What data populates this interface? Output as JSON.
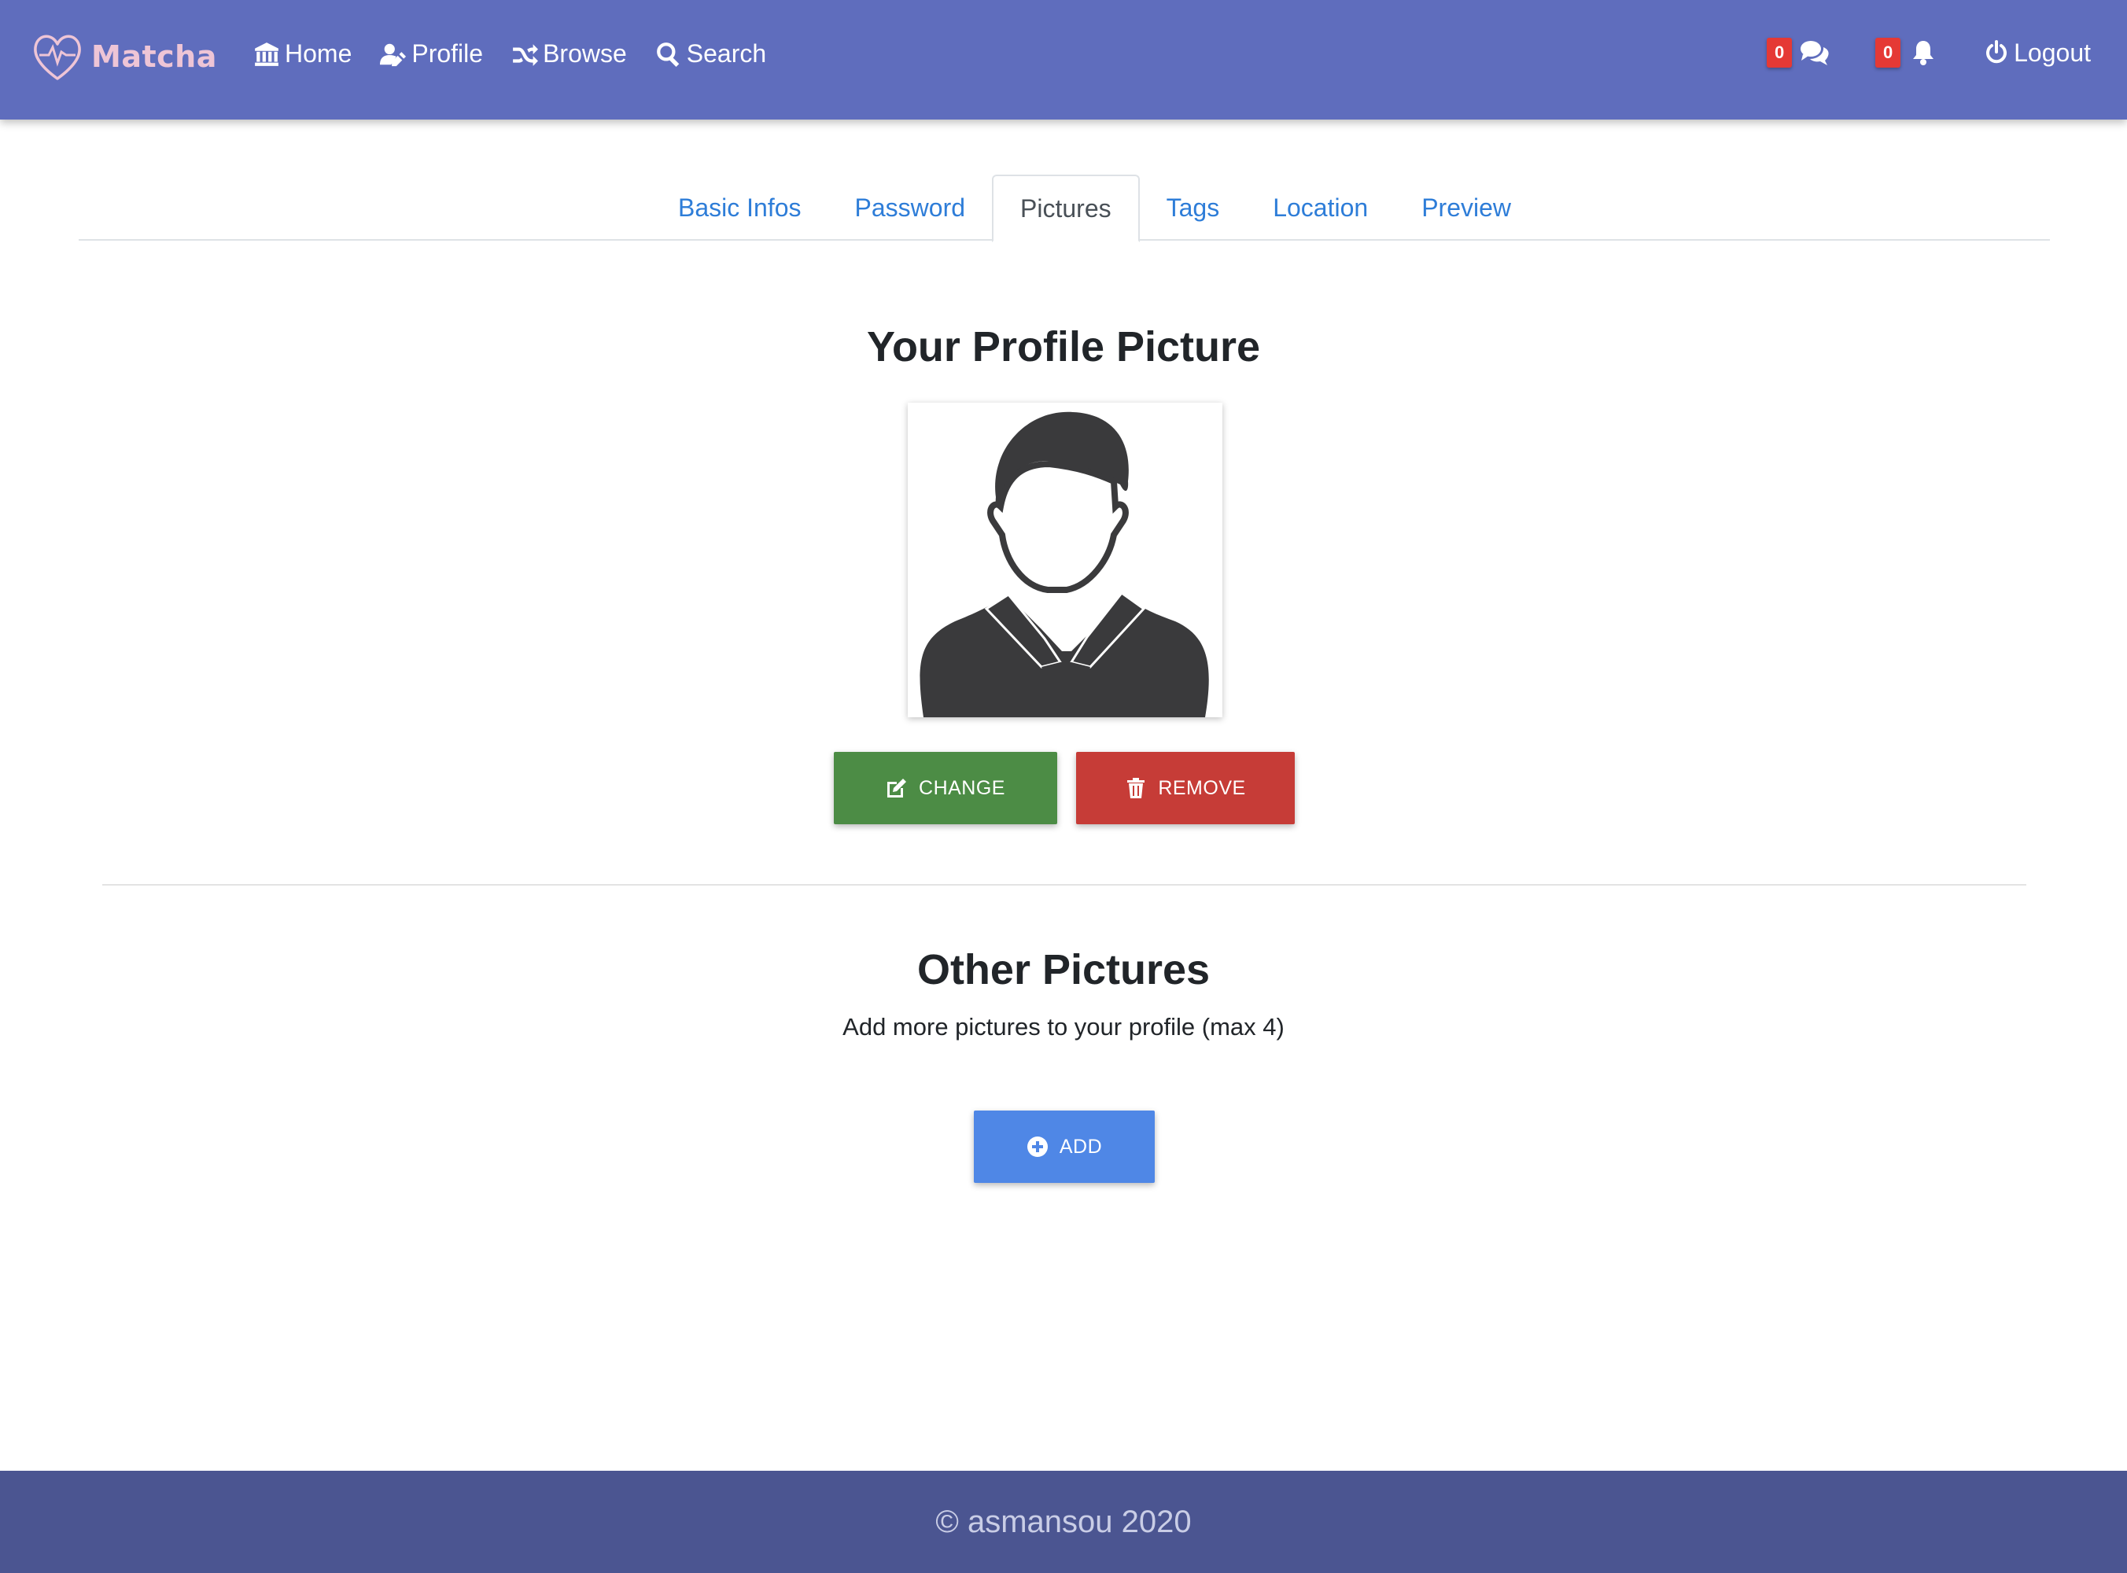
{
  "brand": {
    "name": "Matcha",
    "color": "#eec5d6"
  },
  "navbar": {
    "links": [
      {
        "label": "Home",
        "icon": "bank-icon"
      },
      {
        "label": "Profile",
        "icon": "user-edit-icon"
      },
      {
        "label": "Browse",
        "icon": "shuffle-icon"
      },
      {
        "label": "Search",
        "icon": "search-icon"
      }
    ],
    "messages_count": "0",
    "notifications_count": "0",
    "logout_label": "Logout",
    "background": "#5f6dbd"
  },
  "tabs": [
    {
      "label": "Basic Infos",
      "active": false
    },
    {
      "label": "Password",
      "active": false
    },
    {
      "label": "Pictures",
      "active": true
    },
    {
      "label": "Tags",
      "active": false
    },
    {
      "label": "Location",
      "active": false
    },
    {
      "label": "Preview",
      "active": false
    }
  ],
  "profile_section": {
    "title": "Your Profile Picture",
    "change_label": "CHANGE",
    "remove_label": "REMOVE"
  },
  "other_section": {
    "title": "Other Pictures",
    "subtitle": "Add more pictures to your profile (max 4)",
    "add_label": "ADD"
  },
  "footer": {
    "text": "© asmansou 2020",
    "background": "#4b5591"
  },
  "colors": {
    "change_button": "#4c8c45",
    "remove_button": "#c63c37",
    "add_button": "#4f87e6",
    "badge": "#e53935",
    "tab_link": "#2e7dd8"
  }
}
